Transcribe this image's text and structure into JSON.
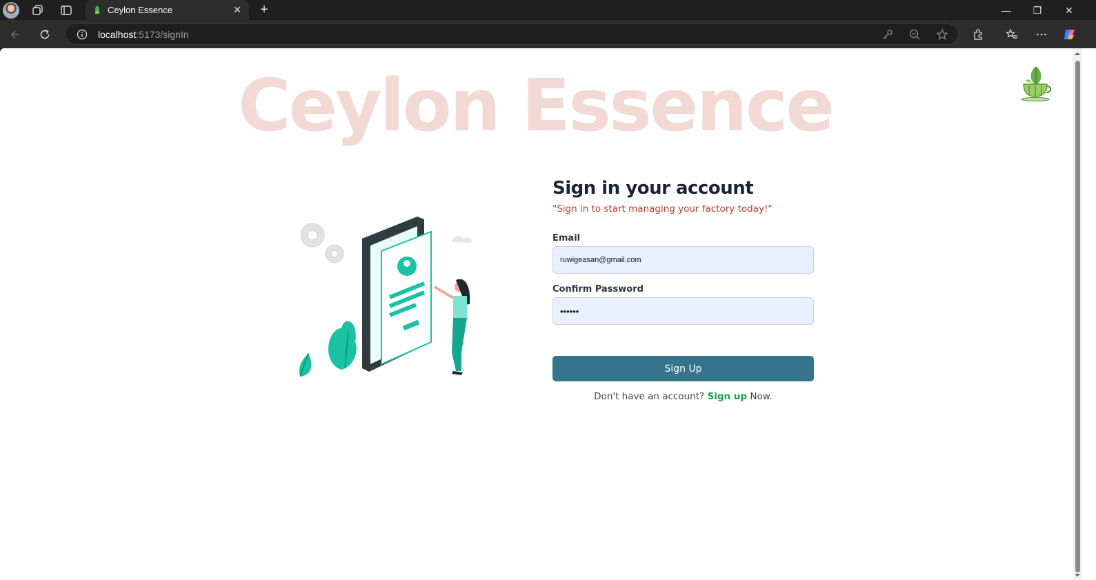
{
  "browser": {
    "tab": {
      "title": "Ceylon Essence",
      "close_glyph": "✕"
    },
    "new_tab_glyph": "+",
    "window_controls": {
      "minimize": "—",
      "restore": "❐",
      "close": "✕"
    },
    "url": {
      "host": "localhost",
      "path": ":5173/signIn"
    },
    "icons": [
      "profile-avatar",
      "workspaces-icon",
      "tab-actions-icon",
      "back-icon",
      "refresh-icon",
      "site-info-icon",
      "key-icon",
      "zoom-out-icon",
      "favorite-star-icon",
      "extensions-icon",
      "favorites-icon",
      "more-icon",
      "copilot-icon"
    ]
  },
  "page": {
    "brand": "Ceylon Essence",
    "heading": "Sign in your account",
    "subtitle": "\"Sign in to start managing your factory today!\"",
    "email": {
      "label": "Email",
      "value": "ruwigeasan@gmail.com"
    },
    "password": {
      "label": "Confirm Password",
      "value": "••••••"
    },
    "submit_label": "Sign Up",
    "footer": {
      "prefix": "Don't have an account?",
      "link": "Sign up",
      "suffix": "Now."
    }
  },
  "colors": {
    "accent": "#35748a",
    "brand_watermark": "#f2d9d3",
    "subtitle": "#c0392b",
    "link": "#16a34a",
    "input_bg": "#e8effd",
    "illustration_teal": "#19c2a3"
  }
}
